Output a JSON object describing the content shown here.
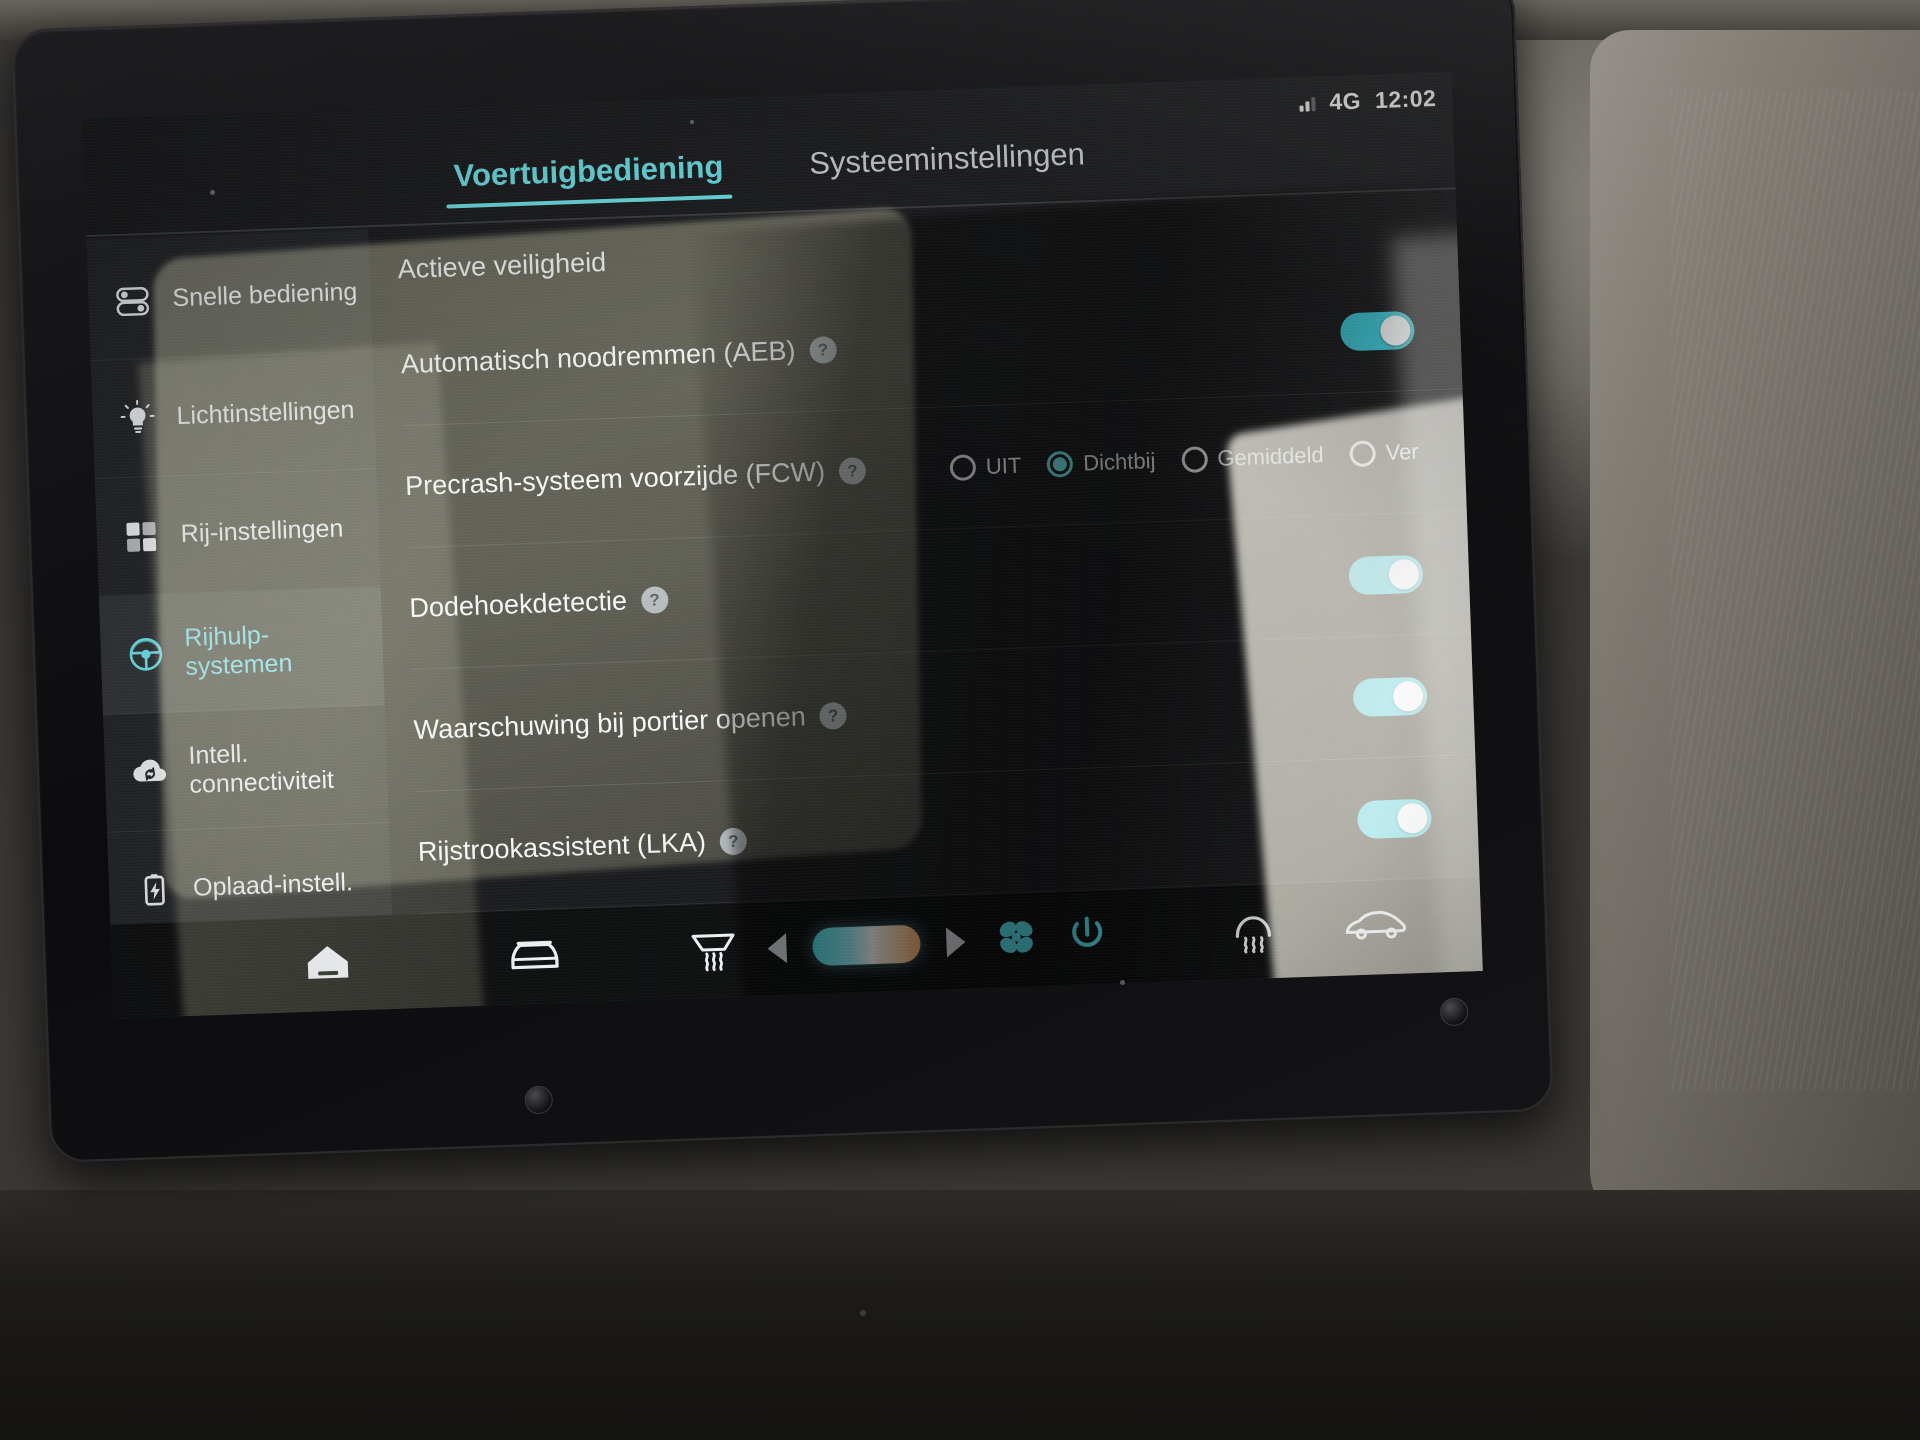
{
  "statusbar": {
    "signal_icon": "signal-bars-icon",
    "network": "4G",
    "time": "12:02"
  },
  "tabs": [
    {
      "label": "Voertuigbediening",
      "active": true
    },
    {
      "label": "Systeeminstellingen",
      "active": false
    }
  ],
  "sidebar": {
    "items": [
      {
        "label": "Snelle bediening",
        "icon": "sliders-toggle-icon",
        "active": false
      },
      {
        "label": "Lichtinstellingen",
        "icon": "lightbulb-icon",
        "active": false
      },
      {
        "label": "Rij-instellingen",
        "icon": "grid-squares-icon",
        "active": false
      },
      {
        "label": "Rijhulp-systemen",
        "icon": "steering-wheel-icon",
        "active": true
      },
      {
        "label": "Intell. connectiviteit",
        "icon": "cloud-sync-icon",
        "active": false
      },
      {
        "label": "Oplaad-instell.",
        "icon": "battery-bolt-icon",
        "active": false
      }
    ]
  },
  "main": {
    "title": "Actieve veiligheid",
    "help_glyph": "?",
    "rows": [
      {
        "label": "Automatisch noodremmen (AEB)",
        "control": "toggle",
        "toggle_on": true
      },
      {
        "label": "Precrash-systeem voorzijde (FCW)",
        "control": "radio",
        "options": [
          {
            "label": "UIT",
            "selected": false
          },
          {
            "label": "Dichtbij",
            "selected": true
          },
          {
            "label": "Gemiddeld",
            "selected": false
          },
          {
            "label": "Ver",
            "selected": false
          }
        ]
      },
      {
        "label": "Dodehoekdetectie",
        "control": "toggle",
        "toggle_on": true
      },
      {
        "label": "Waarschuwing bij portier openen",
        "control": "toggle",
        "toggle_on": true
      },
      {
        "label": "Rijstrookassistent (LKA)",
        "control": "toggle",
        "toggle_on": true
      }
    ]
  },
  "dock": {
    "home_icon": "home-icon",
    "car_icon": "car-front-icon",
    "rear_defrost_icon": "rear-defrost-icon",
    "temp_decrease_icon": "triangle-left-icon",
    "temp_slider_icon": "temperature-slider",
    "temp_increase_icon": "triangle-right-icon",
    "fan_icon": "fan-icon",
    "power_icon": "power-icon",
    "front_defrost_icon": "front-defrost-icon",
    "car_rear_icon": "car-side-icon"
  },
  "colors": {
    "accent": "#6ee4ea",
    "toggle_on": "#3fc8d6",
    "screen_bg": "#1b1c1e",
    "sidebar_bg": "#242629"
  }
}
